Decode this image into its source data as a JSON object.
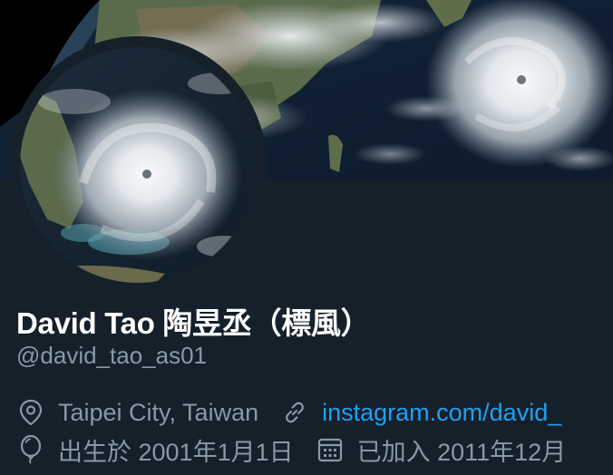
{
  "profile": {
    "name": "David Tao 陶昱丞（標風）",
    "handle": "@david_tao_as01",
    "location": "Taipei City, Taiwan",
    "website": "instagram.com/david_",
    "birthday": "出生於 2001年1月1日",
    "joined": "已加入 2011年12月"
  },
  "icons": {
    "location": "location-pin-icon",
    "link": "link-icon",
    "birthday": "balloon-icon",
    "joined": "calendar-icon"
  },
  "colors": {
    "background": "#15202b",
    "primary_text": "#ffffff",
    "secondary_text": "#8899a6",
    "link": "#1da1f2"
  }
}
